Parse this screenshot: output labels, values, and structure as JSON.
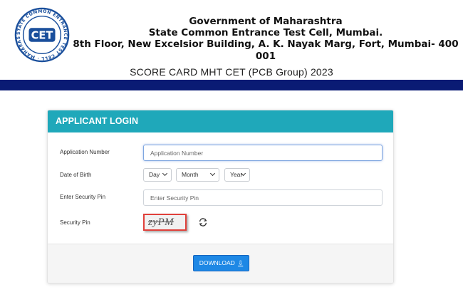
{
  "header": {
    "logo_text": "CET",
    "logo_ring_text": "STATE COMMON ENTRANCE TEST CELL · MAHARASHTRA",
    "line1": "Government of Maharashtra",
    "line2": "State Common Entrance Test Cell, Mumbai.",
    "line3": "8th Floor, New Excelsior Building, A. K. Nayak Marg, Fort, Mumbai- 400 001",
    "score_card_title": "SCORE CARD MHT CET (PCB Group) 2023"
  },
  "colors": {
    "nav_bar": "#0a1b74",
    "panel_header": "#1fa8ba",
    "button": "#1e88e5",
    "captcha_border": "#e0403a"
  },
  "login": {
    "title": "APPLICANT LOGIN",
    "application_number": {
      "label": "Application Number",
      "placeholder": "Application Number",
      "value": ""
    },
    "dob": {
      "label": "Date of Birth",
      "day": "Day",
      "month": "Month",
      "year": "Year"
    },
    "security_pin_input": {
      "label": "Enter Security Pin",
      "placeholder": "Enter Security Pin",
      "value": ""
    },
    "security_pin": {
      "label": "Security Pin",
      "captcha_text": "zyPM",
      "refresh_icon": "refresh-icon"
    },
    "download_button": {
      "label": "DOWNLOAD",
      "icon": "download-icon"
    }
  }
}
